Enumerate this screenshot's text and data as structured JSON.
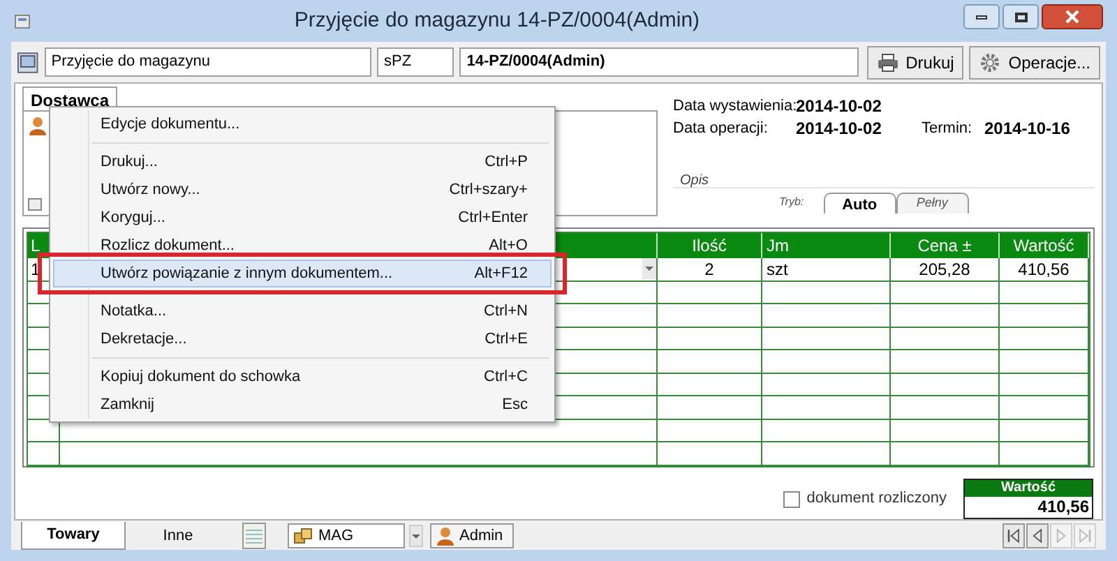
{
  "window": {
    "title": "Przyjęcie do magazynu 14-PZ/0004(Admin)"
  },
  "toolbar": {
    "document_type": "Przyjęcie do magazynu",
    "series": "sPZ",
    "number": "14-PZ/0004(Admin)",
    "buttons": [
      {
        "kind": "print",
        "label": "Drukuj"
      },
      {
        "kind": "gear",
        "label": "Operacje..."
      }
    ]
  },
  "supplier_tab": {
    "label": "Dostawca"
  },
  "dates": {
    "issue": {
      "label": "Data wystawienia:",
      "value": "2014-10-02"
    },
    "operation": {
      "label": "Data operacji:",
      "value": "2014-10-02"
    },
    "due": {
      "label": "Termin:",
      "value": "2014-10-16"
    }
  },
  "description_label": "Opis",
  "mode": {
    "label": "Tryb:",
    "tabs": [
      {
        "label": "Auto",
        "selected": true
      },
      {
        "label": "Pełny",
        "selected": false
      }
    ]
  },
  "table": {
    "columns": [
      "L",
      "",
      "Ilość",
      "Jm",
      "Cena ±",
      "Wartość"
    ],
    "rows": [
      [
        "1",
        "",
        "2",
        "szt",
        "205,28",
        "410,56"
      ]
    ]
  },
  "settled": {
    "label": "dokument rozliczony",
    "checked": false
  },
  "total": {
    "label": "Wartość",
    "value": "410,56"
  },
  "bottom_tabs": [
    {
      "label": "Towary",
      "selected": true
    },
    {
      "label": "Inne",
      "selected": false
    }
  ],
  "warehouse": {
    "value": "MAG"
  },
  "user": {
    "value": "Admin"
  },
  "navigation": [
    {
      "kind": "first",
      "disabled": false
    },
    {
      "kind": "prev",
      "disabled": false
    },
    {
      "kind": "next",
      "disabled": true
    },
    {
      "kind": "last",
      "disabled": true
    }
  ],
  "context_menu": [
    {
      "kind": "item",
      "label": "Edycje dokumentu...",
      "highlighted": false
    },
    {
      "kind": "separator"
    },
    {
      "kind": "item",
      "label": "Drukuj...",
      "shortcut": "Ctrl+P",
      "highlighted": false
    },
    {
      "kind": "item",
      "label": "Utwórz nowy...",
      "shortcut": "Ctrl+szary+",
      "highlighted": false
    },
    {
      "kind": "item",
      "label": "Koryguj...",
      "shortcut": "Ctrl+Enter",
      "highlighted": false
    },
    {
      "kind": "item",
      "label": "Rozlicz dokument...",
      "shortcut": "Alt+O",
      "highlighted": false
    },
    {
      "kind": "item",
      "label": "Utwórz powiązanie z innym dokumentem...",
      "shortcut": "Alt+F12",
      "highlighted": true
    },
    {
      "kind": "separator"
    },
    {
      "kind": "item",
      "label": "Notatka...",
      "shortcut": "Ctrl+N",
      "highlighted": false
    },
    {
      "kind": "item",
      "label": "Dekretacje...",
      "shortcut": "Ctrl+E",
      "highlighted": false
    },
    {
      "kind": "separator"
    },
    {
      "kind": "item",
      "label": "Kopiuj dokument do schowka",
      "shortcut": "Ctrl+C",
      "highlighted": false
    },
    {
      "kind": "item",
      "label": "Zamknij",
      "shortcut": "Esc",
      "highlighted": false
    }
  ]
}
